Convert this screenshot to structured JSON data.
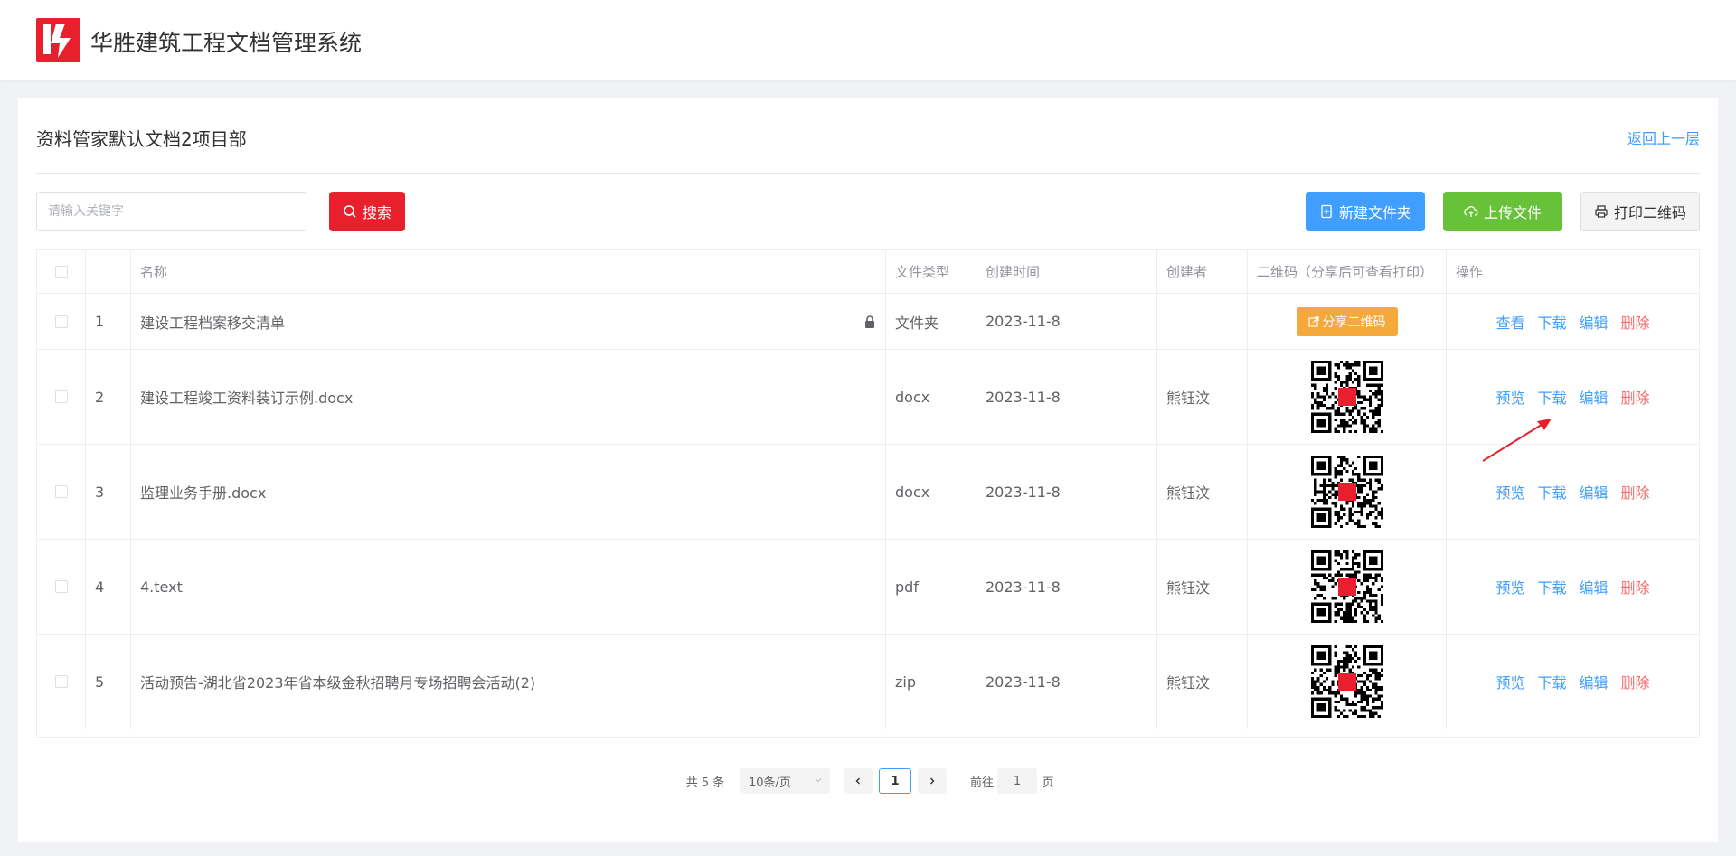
{
  "header": {
    "app_title": "华胜建筑工程文档管理系统",
    "logo_color": "#e8202e"
  },
  "panel": {
    "title": "资料管家默认文档2项目部",
    "back_label": "返回上一层"
  },
  "toolbar": {
    "search_placeholder": "请输入关键字",
    "search_label": "搜索",
    "new_folder_label": "新建文件夹",
    "upload_label": "上传文件",
    "print_qr_label": "打印二维码"
  },
  "table": {
    "columns": [
      "名称",
      "文件类型",
      "创建时间",
      "创建者",
      "二维码（分享后可查看打印）",
      "操作"
    ],
    "rows": [
      {
        "index": "1",
        "name": "建设工程档案移交清单",
        "type": "文件夹",
        "created": "2023-11-8",
        "creator": "",
        "share_label": "分享二维码",
        "actions": [
          "查看",
          "下载",
          "编辑",
          "删除"
        ]
      },
      {
        "index": "2",
        "name": "建设工程竣工资料装订示例.docx",
        "type": "docx",
        "created": "2023-11-8",
        "creator": "熊钰汶",
        "actions": [
          "预览",
          "下载",
          "编辑",
          "删除"
        ]
      },
      {
        "index": "3",
        "name": "监理业务手册.docx",
        "type": "docx",
        "created": "2023-11-8",
        "creator": "熊钰汶",
        "actions": [
          "预览",
          "下载",
          "编辑",
          "删除"
        ]
      },
      {
        "index": "4",
        "name": "4.text",
        "type": "pdf",
        "created": "2023-11-8",
        "creator": "熊钰汶",
        "actions": [
          "预览",
          "下载",
          "编辑",
          "删除"
        ]
      },
      {
        "index": "5",
        "name": "活动预告-湖北省2023年省本级金秋招聘月专场招聘会活动(2)",
        "type": "zip",
        "created": "2023-11-8",
        "creator": "熊钰汶",
        "actions": [
          "预览",
          "下载",
          "编辑",
          "删除"
        ]
      }
    ]
  },
  "pagination": {
    "total_label": "共 5 条",
    "page_size_label": "10条/页",
    "current_page": "1",
    "goto_label": "前往",
    "goto_value": "1",
    "page_suffix": "页"
  },
  "colors": {
    "primary": "#409eff",
    "danger": "#f56c6c",
    "success": "#67c23a",
    "warning": "#f5a93a",
    "brand": "#e8202e"
  }
}
